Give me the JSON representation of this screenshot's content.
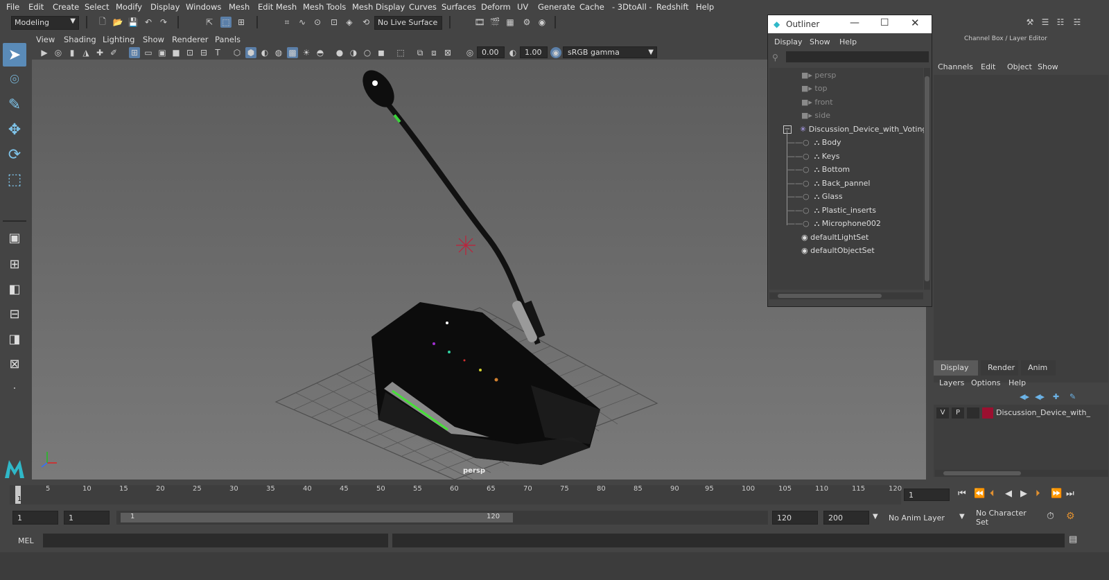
{
  "menu": [
    "File",
    "Edit",
    "Create",
    "Select",
    "Modify",
    "Display",
    "Windows",
    "Mesh",
    "Edit Mesh",
    "Mesh Tools",
    "Mesh Display",
    "Curves",
    "Surfaces",
    "Deform",
    "UV",
    "Generate",
    "Cache",
    "- 3DtoAll -",
    "Redshift",
    "Help"
  ],
  "status": {
    "workspace": "Modeling",
    "live_surface": "No Live Surface"
  },
  "panel_menu": [
    "View",
    "Shading",
    "Lighting",
    "Show",
    "Renderer",
    "Panels"
  ],
  "panel_toolbar": {
    "exposure": "0.00",
    "gamma": "1.00",
    "color_space": "sRGB gamma"
  },
  "viewport": {
    "camera_label": "persp"
  },
  "outliner": {
    "title": "Outliner",
    "menu": [
      "Display",
      "Show",
      "Help"
    ],
    "items": [
      {
        "label": "persp",
        "kind": "camera",
        "dim": true
      },
      {
        "label": "top",
        "kind": "camera",
        "dim": true
      },
      {
        "label": "front",
        "kind": "camera",
        "dim": true
      },
      {
        "label": "side",
        "kind": "camera",
        "dim": true
      },
      {
        "label": "Discussion_Device_with_Voting",
        "kind": "group",
        "dim": false
      },
      {
        "label": "Body",
        "kind": "mesh",
        "dim": false
      },
      {
        "label": "Keys",
        "kind": "mesh",
        "dim": false
      },
      {
        "label": "Bottom",
        "kind": "mesh",
        "dim": false
      },
      {
        "label": "Back_pannel",
        "kind": "mesh",
        "dim": false
      },
      {
        "label": "Glass",
        "kind": "mesh",
        "dim": false
      },
      {
        "label": "Plastic_inserts",
        "kind": "mesh",
        "dim": false
      },
      {
        "label": "Microphone002",
        "kind": "mesh",
        "dim": false
      },
      {
        "label": "defaultLightSet",
        "kind": "set",
        "dim": false
      },
      {
        "label": "defaultObjectSet",
        "kind": "set",
        "dim": false
      }
    ]
  },
  "channel_box": {
    "title": "Channel Box / Layer Editor",
    "menu": [
      "Channels",
      "Edit",
      "Object",
      "Show"
    ],
    "tabs": [
      "Display",
      "Render",
      "Anim"
    ],
    "layer_menu": [
      "Layers",
      "Options",
      "Help"
    ],
    "layer": {
      "v": "V",
      "p": "P",
      "name": "Discussion_Device_with_",
      "color": "#9b1030"
    }
  },
  "timeline": {
    "ticks": [
      "5",
      "10",
      "15",
      "20",
      "25",
      "30",
      "35",
      "40",
      "45",
      "50",
      "55",
      "60",
      "65",
      "70",
      "75",
      "80",
      "85",
      "90",
      "95",
      "100",
      "105",
      "110",
      "115",
      "120"
    ],
    "current_frame_marker": "1",
    "current_frame": "1"
  },
  "range": {
    "start": "1",
    "anim_start": "1",
    "slider_start": "1",
    "slider_end": "120",
    "end": "120",
    "anim_end": "200",
    "anim_layer": "No Anim Layer",
    "character_set": "No Character Set"
  },
  "mel": {
    "label": "MEL"
  },
  "colors": {
    "accent": "#5b7fa8",
    "viewport_bg": "#6b6b6b",
    "panel_bg": "#444444"
  }
}
